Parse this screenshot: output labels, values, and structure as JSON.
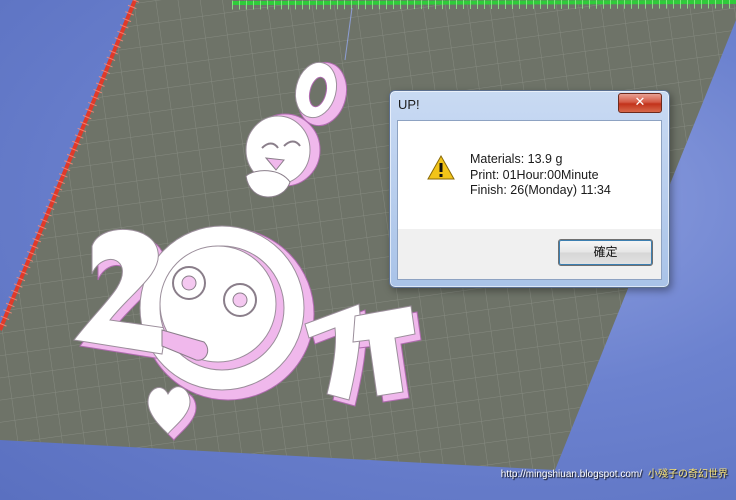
{
  "dialog": {
    "title": "UP!",
    "close_symbol": "✕",
    "icon": "warning-icon",
    "lines": [
      "Materials: 13.9 g",
      "Print: 01Hour:00Minute",
      "Finish: 26(Monday) 11:34"
    ],
    "ok_label": "確定"
  },
  "watermark": {
    "url": "http://mingshiuan.blogspot.com/",
    "author": "小殘子の奇幻世界"
  },
  "colors": {
    "background": "#6f84c9",
    "platform": "#6e7368",
    "model": "#ffffff",
    "model_side": "#f0b8ec",
    "ruler_red": "#e03a2a",
    "ruler_green": "#2fcc3a"
  }
}
